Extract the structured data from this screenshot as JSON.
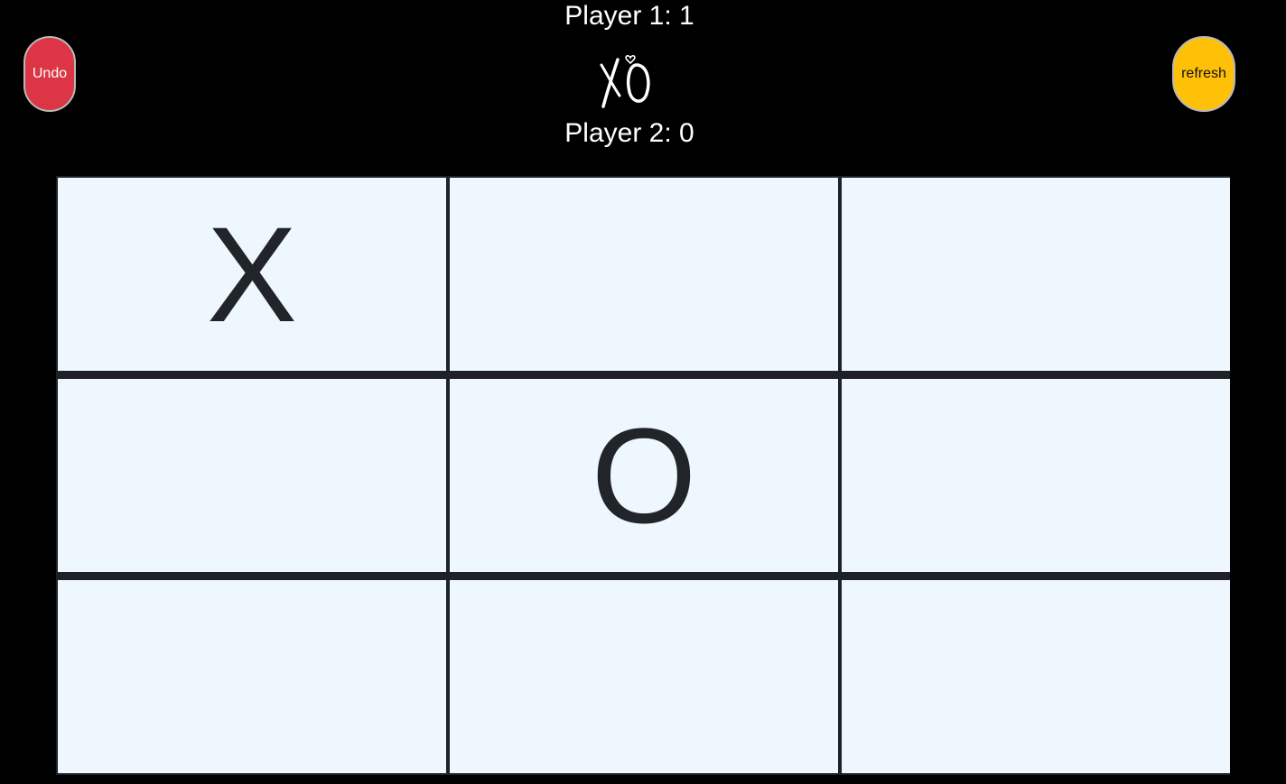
{
  "score": {
    "player1": "Player 1: 1",
    "player2": "Player 2: 0"
  },
  "logo": {
    "text": "XO",
    "icon": "xo-logo-icon"
  },
  "buttons": {
    "undo_label": "Undo",
    "refresh_label": "refresh"
  },
  "board": {
    "cells": [
      "X",
      "",
      "",
      "",
      "O",
      "",
      "",
      "",
      ""
    ]
  },
  "colors": {
    "background": "#000000",
    "undo": "#dc3545",
    "refresh": "#ffc107",
    "cell": "#eef6fe",
    "grid": "#1e2227",
    "mark": "#212529"
  }
}
